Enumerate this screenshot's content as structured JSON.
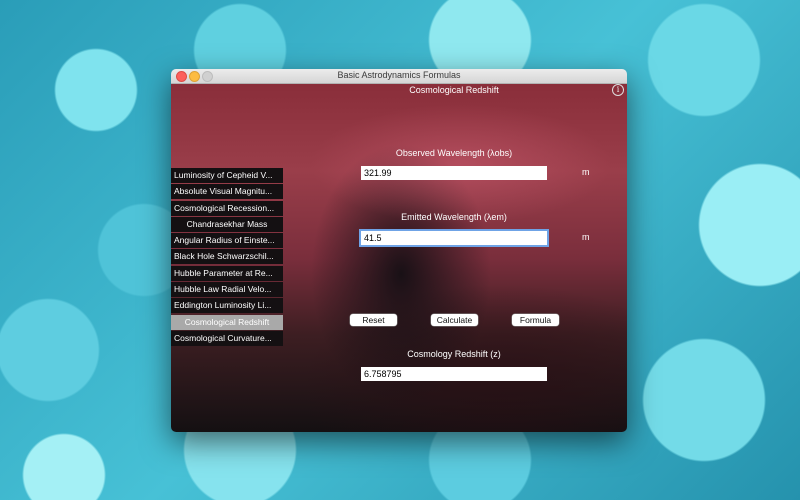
{
  "window": {
    "title": "Basic Astrodynamics Formulas"
  },
  "header": {
    "title": "Cosmological Redshift",
    "info_icon": "i"
  },
  "sidebar": {
    "items": [
      {
        "label": "Luminosity of Cepheid V..."
      },
      {
        "label": "Absolute Visual Magnitu..."
      },
      {
        "label": "Cosmological Recession..."
      },
      {
        "label": "Chandrasekhar Mass"
      },
      {
        "label": "Angular Radius of Einste..."
      },
      {
        "label": "Black Hole Schwarzschil..."
      },
      {
        "label": "Hubble Parameter at Re..."
      },
      {
        "label": "Hubble Law Radial Velo..."
      },
      {
        "label": "Eddington Luminosity Li..."
      },
      {
        "label": "Cosmological Redshift",
        "selected": true
      },
      {
        "label": "Cosmological Curvature..."
      }
    ]
  },
  "form": {
    "observed": {
      "label": "Observed Wavelength (λobs)",
      "value": "321.99",
      "unit": "m"
    },
    "emitted": {
      "label": "Emitted Wavelength (λem)",
      "value": "41.5",
      "unit": "m"
    },
    "buttons": {
      "reset": "Reset",
      "calculate": "Calculate",
      "formula": "Formula"
    },
    "result": {
      "label": "Cosmology Redshift (z)",
      "value": "6.758795"
    }
  }
}
